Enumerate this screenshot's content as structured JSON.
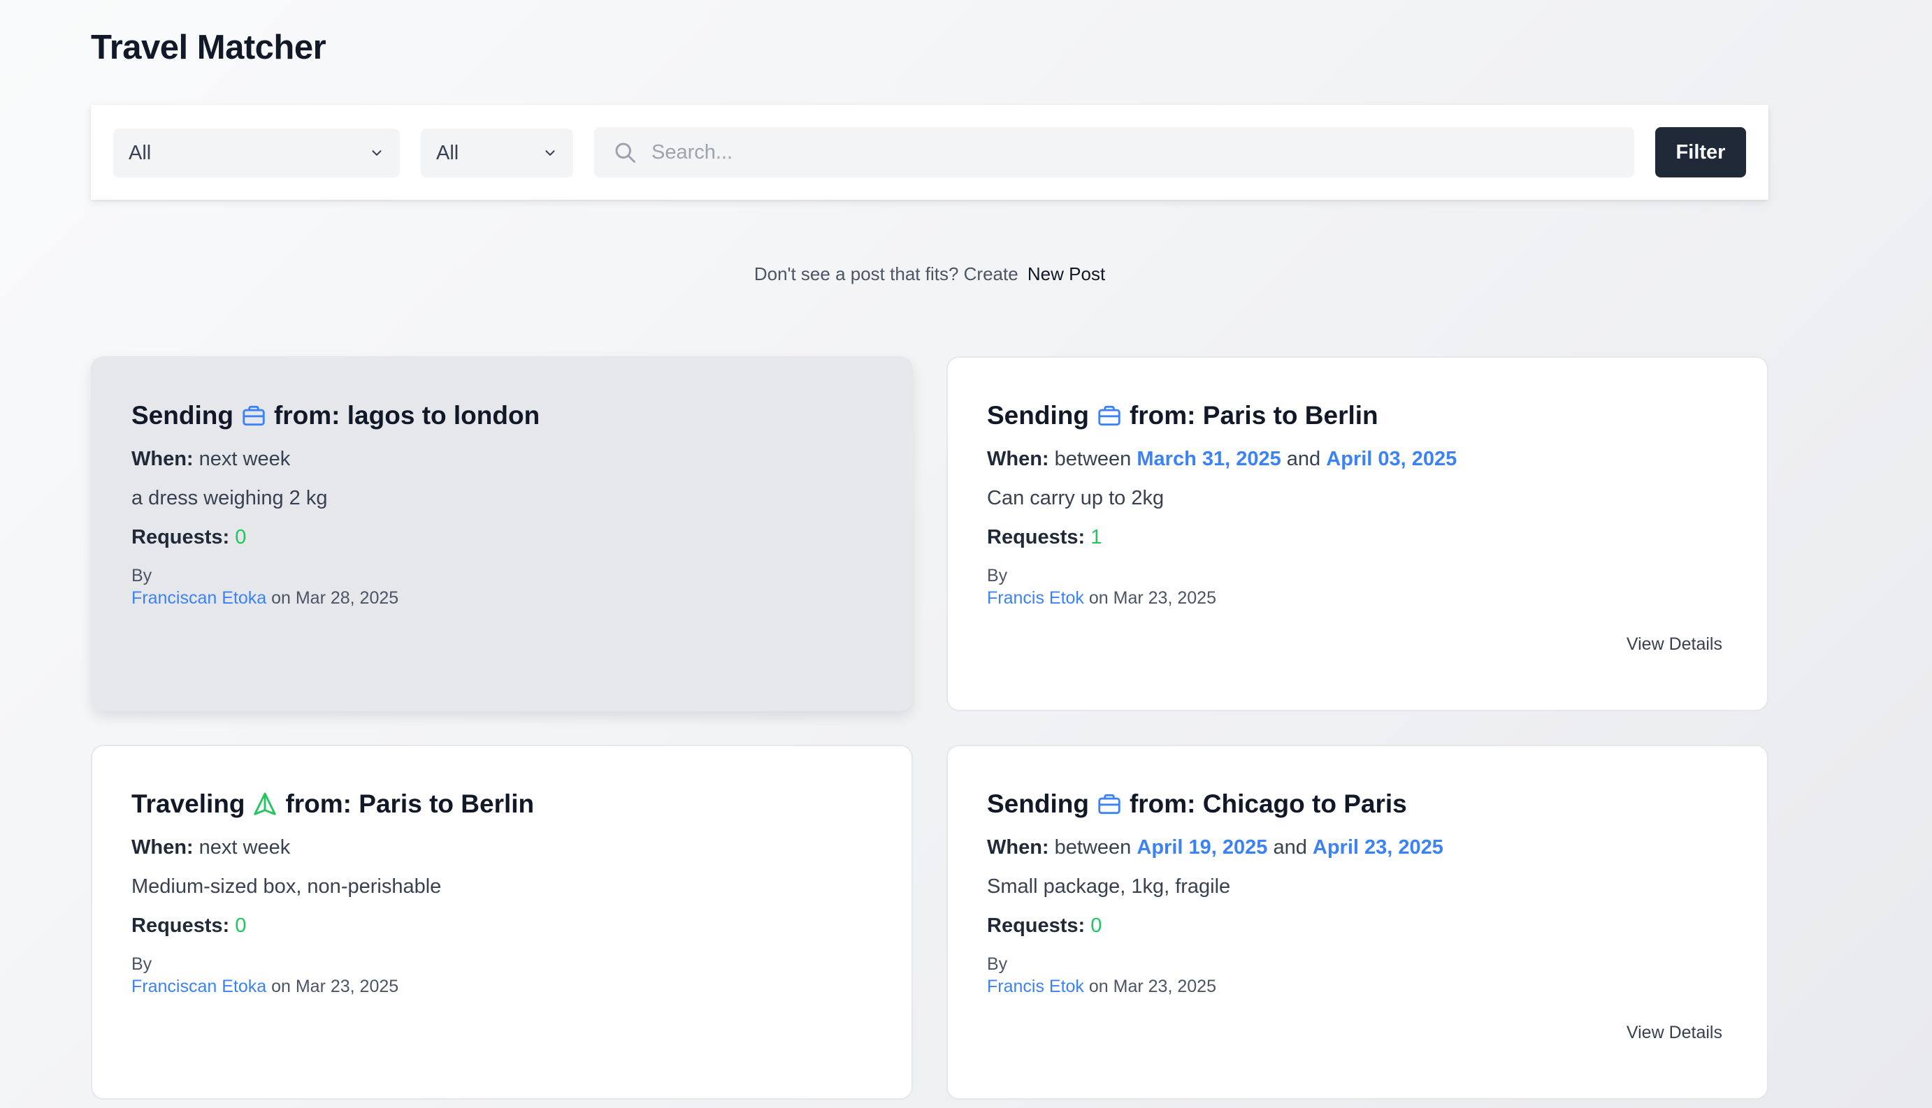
{
  "app": {
    "title": "Travel Matcher"
  },
  "filters": {
    "type_select": "All",
    "category_select": "All",
    "search_placeholder": "Search...",
    "filter_button": "Filter"
  },
  "cta": {
    "text": "Don't see a post that fits? Create",
    "link": "New Post"
  },
  "labels": {
    "when": "When:",
    "requests": "Requests:",
    "by": "By",
    "between": "between",
    "and": "and",
    "from": "from:",
    "on": "on",
    "view_details": "View Details"
  },
  "posts": [
    {
      "kind": "Sending",
      "icon": "briefcase-icon",
      "route": "lagos to london",
      "when": "next week",
      "description": "a dress weighing 2 kg",
      "requests": "0",
      "author": "Franciscan Etoka",
      "date": "Mar 28, 2025",
      "hovered": true,
      "show_view_details": false
    },
    {
      "kind": "Sending",
      "icon": "briefcase-icon",
      "route": "Paris to Berlin",
      "when_start": "March 31, 2025",
      "when_end": "April 03, 2025",
      "description": "Can carry up to 2kg",
      "requests": "1",
      "author": "Francis Etok",
      "date": "Mar 23, 2025",
      "show_view_details": true
    },
    {
      "kind": "Traveling",
      "icon": "send-arrow-icon",
      "route": "Paris to Berlin",
      "when": "next week",
      "description": "Medium-sized box, non-perishable",
      "requests": "0",
      "author": "Franciscan Etoka",
      "date": "Mar 23, 2025",
      "show_view_details": false
    },
    {
      "kind": "Sending",
      "icon": "briefcase-icon",
      "route": "Chicago to Paris",
      "when_start": "April 19, 2025",
      "when_end": "April 23, 2025",
      "description": "Small package, 1kg, fragile",
      "requests": "0",
      "author": "Francis Etok",
      "date": "Mar 23, 2025",
      "show_view_details": true
    }
  ],
  "colors": {
    "accent_blue": "#3b82f6",
    "success_green": "#22c55e",
    "dark_button": "#1f2937",
    "traveling_icon": "#22c55e"
  }
}
